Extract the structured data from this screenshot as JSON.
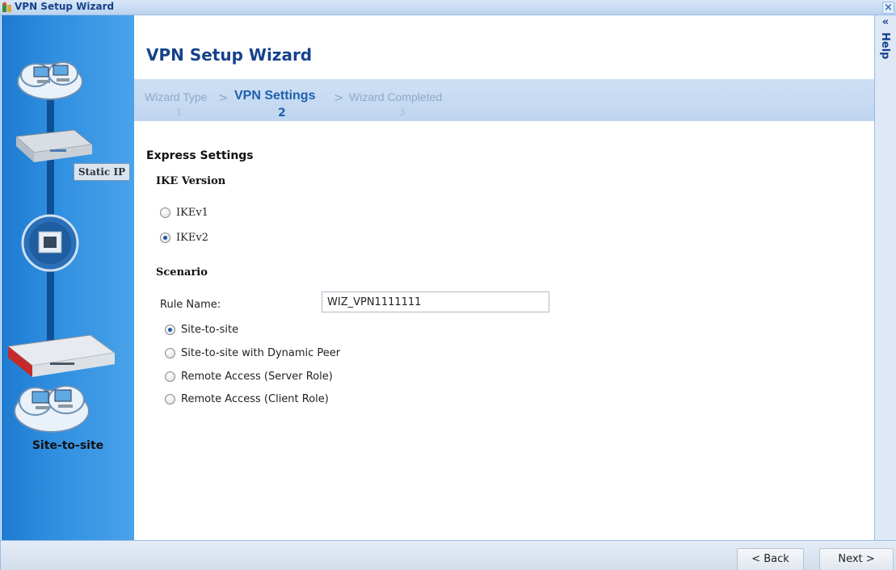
{
  "window": {
    "title": "VPN Setup Wizard",
    "close_symbol": "×"
  },
  "sidebar": {
    "device_label": "Static IP",
    "scenario_label": "Site-to-site"
  },
  "main": {
    "title": "VPN Setup Wizard",
    "steps": [
      {
        "label": "Wizard Type",
        "number": "1",
        "active": false
      },
      {
        "label": "VPN Settings",
        "number": "2",
        "active": true
      },
      {
        "label": "Wizard Completed",
        "number": "3",
        "active": false
      }
    ],
    "step_separator": ">",
    "express_settings_title": "Express Settings",
    "ike_version": {
      "title": "IKE Version",
      "options": [
        {
          "label": "IKEv1",
          "checked": false
        },
        {
          "label": "IKEv2",
          "checked": true
        }
      ]
    },
    "scenario": {
      "title": "Scenario",
      "rule_name_label": "Rule Name:",
      "rule_name_value": "WIZ_VPN1111111",
      "options": [
        {
          "label": "Site-to-site",
          "checked": true
        },
        {
          "label": "Site-to-site with Dynamic Peer",
          "checked": false
        },
        {
          "label": "Remote Access (Server Role)",
          "checked": false
        },
        {
          "label": "Remote Access (Client Role)",
          "checked": false
        }
      ]
    }
  },
  "help_panel": {
    "label": "Help",
    "collapse_symbol": "«"
  },
  "footer": {
    "back_label": "< Back",
    "next_label": "Next >"
  },
  "icons": [
    "wizard-app-icon",
    "close-icon",
    "collapse-left-icon",
    "cloud-network-icon",
    "router-icon",
    "ethernet-port-icon",
    "firewall-device-icon"
  ]
}
